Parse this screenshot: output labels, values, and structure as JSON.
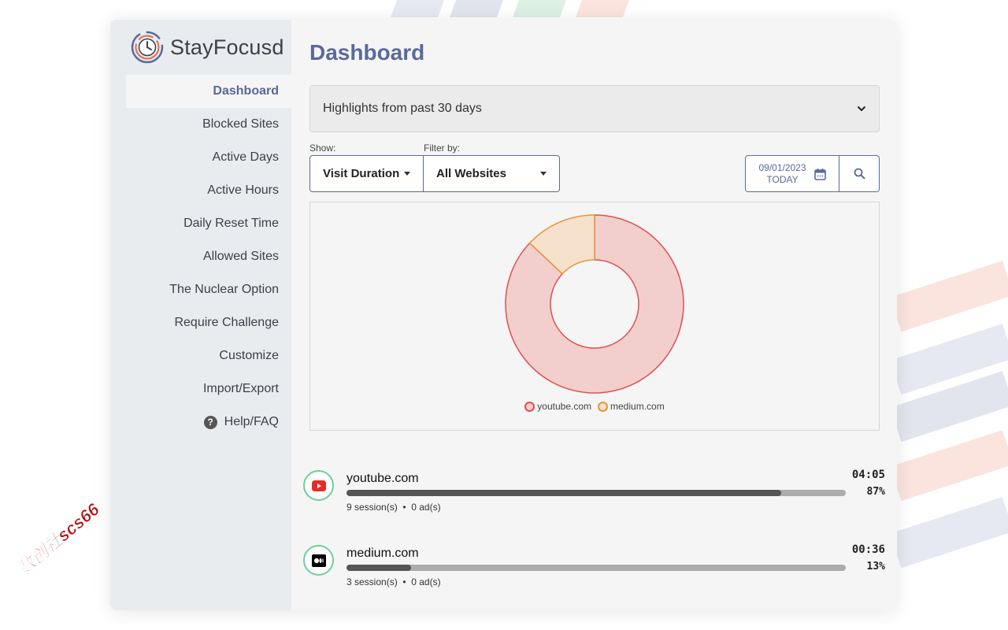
{
  "app": {
    "name": "StayFocusd",
    "colors": {
      "accent": "#5a6a9a",
      "youtube": "#e05050",
      "medium": "#e8953a",
      "status_ring": "#6dcf9a"
    }
  },
  "sidebar": {
    "items": [
      {
        "label": "Dashboard",
        "active": true
      },
      {
        "label": "Blocked Sites"
      },
      {
        "label": "Active Days"
      },
      {
        "label": "Active Hours"
      },
      {
        "label": "Daily Reset Time"
      },
      {
        "label": "Allowed Sites"
      },
      {
        "label": "The Nuclear Option"
      },
      {
        "label": "Require Challenge"
      },
      {
        "label": "Customize"
      },
      {
        "label": "Import/Export"
      },
      {
        "label": "Help/FAQ",
        "icon": "question-circle-icon"
      }
    ]
  },
  "main": {
    "title": "Dashboard",
    "highlights": {
      "label": "Highlights from past 30 days"
    },
    "show": {
      "label": "Show:",
      "value": "Visit Duration"
    },
    "filter": {
      "label": "Filter by:",
      "value": "All Websites"
    },
    "date": {
      "value": "09/01/2023",
      "sub": "TODAY"
    }
  },
  "chart_data": {
    "type": "pie",
    "style": "donut",
    "categories": [
      "youtube.com",
      "medium.com"
    ],
    "values": [
      87,
      13
    ],
    "legend": "bottom"
  },
  "sites": [
    {
      "name": "youtube.com",
      "time": "04:05",
      "percent": "87%",
      "fraction": 0.87,
      "sessions": "9 session(s)",
      "ads": "0 ad(s)",
      "icon": "youtube-icon"
    },
    {
      "name": "medium.com",
      "time": "00:36",
      "percent": "13%",
      "fraction": 0.13,
      "sessions": "3 session(s)",
      "ads": "0 ad(s)",
      "icon": "medium-icon"
    }
  ],
  "meta_separator": "•",
  "watermark": "数创社scs66"
}
